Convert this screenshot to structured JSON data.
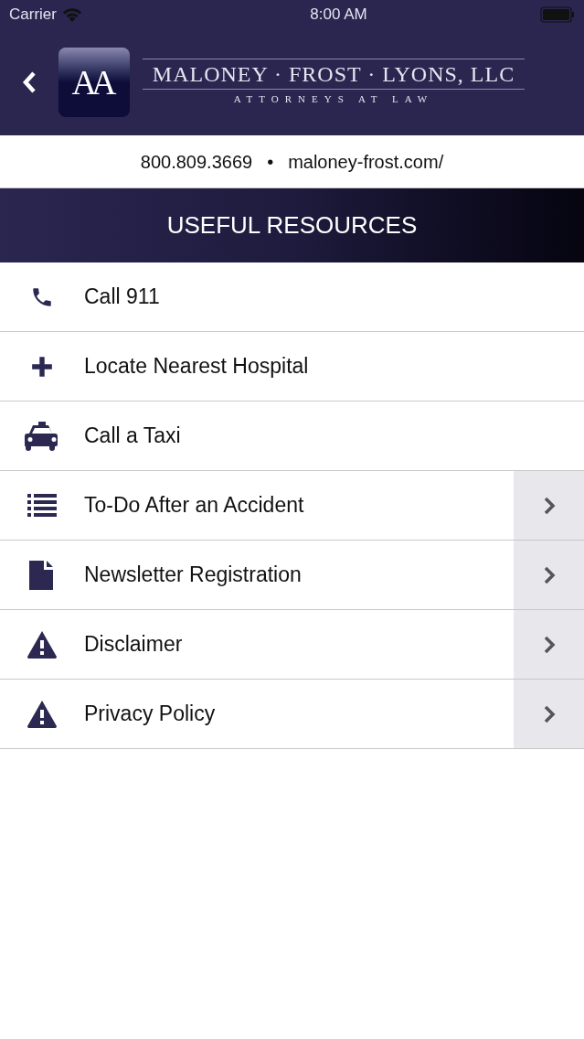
{
  "status_bar": {
    "carrier": "Carrier",
    "time": "8:00 AM"
  },
  "header": {
    "logo_monogram": "AA",
    "firm_name": "MALONEY · FROST · LYONS, LLC",
    "tagline": "ATTORNEYS AT LAW"
  },
  "contact": {
    "phone": "800.809.3669",
    "separator": "•",
    "website": "maloney-frost.com/"
  },
  "title": "USEFUL RESOURCES",
  "items": [
    {
      "label": "Call 911",
      "kind": "action"
    },
    {
      "label": "Locate Nearest Hospital",
      "kind": "action"
    },
    {
      "label": "Call a Taxi",
      "kind": "action"
    },
    {
      "label": "To-Do After an Accident",
      "kind": "link"
    },
    {
      "label": "Newsletter Registration",
      "kind": "link"
    },
    {
      "label": "Disclaimer",
      "kind": "link"
    },
    {
      "label": "Privacy Policy",
      "kind": "link"
    }
  ]
}
